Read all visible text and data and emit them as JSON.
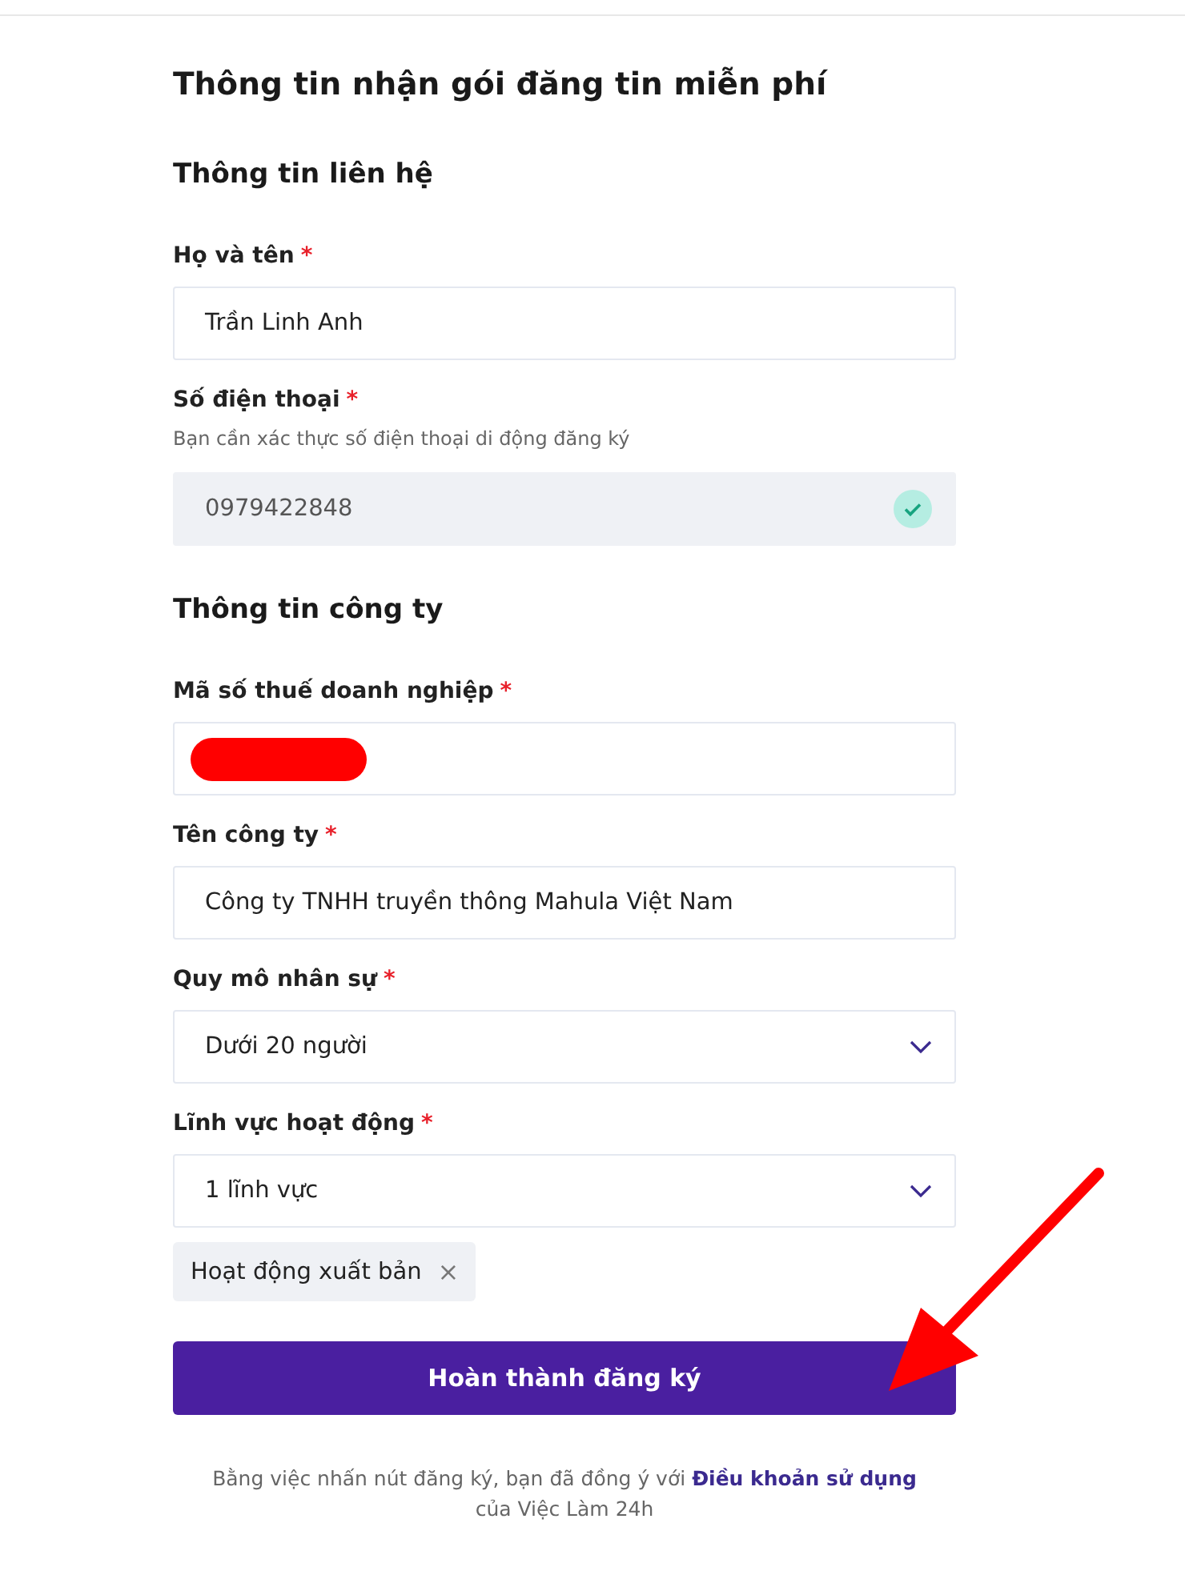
{
  "title": "Thông tin nhận gói đăng tin miễn phí",
  "sections": [
    {
      "heading": "Thông tin liên hệ",
      "fields": [
        {
          "kind": "text",
          "label": "Họ và tên",
          "required_mark": "*",
          "value": "Trần Linh Anh"
        },
        {
          "kind": "phone",
          "label": "Số điện thoại",
          "required_mark": "*",
          "hint": "Bạn cần xác thực số điện thoại di động đăng ký",
          "value": "0979422848",
          "disabled": true,
          "verified": true
        }
      ]
    },
    {
      "heading": "Thông tin công ty",
      "fields": [
        {
          "kind": "redacted",
          "label": "Mã số thuế doanh nghiệp",
          "required_mark": "*"
        },
        {
          "kind": "text",
          "label": "Tên công ty",
          "required_mark": "*",
          "value": "Công ty TNHH truyền thông Mahula Việt Nam"
        },
        {
          "kind": "select",
          "label": "Quy mô nhân sự",
          "required_mark": "*",
          "value": "Dưới 20 người"
        },
        {
          "kind": "select",
          "label": "Lĩnh vực hoạt động",
          "required_mark": "*",
          "value": "1 lĩnh vực",
          "tags": [
            {
              "label": "Hoạt động xuất bản",
              "remove": "×"
            }
          ]
        }
      ]
    }
  ],
  "submit": "Hoàn thành đăng ký",
  "footer": {
    "text": "Bằng việc nhấn nút đăng ký, bạn đã đồng ý với",
    "link": "Điều khoản sử dụng",
    "after": "của Việc Làm 24h"
  },
  "annotation": {
    "kind": "arrow"
  }
}
